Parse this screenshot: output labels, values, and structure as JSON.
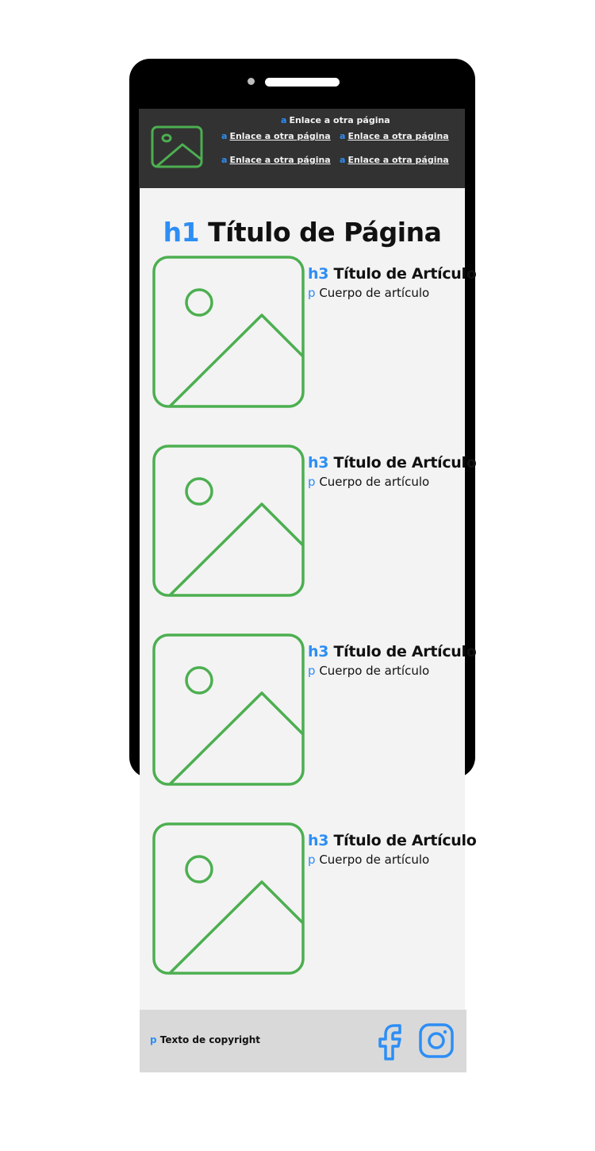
{
  "header": {
    "logo_icon": "image-placeholder-icon",
    "link_tag": "a",
    "links": [
      "Enlace a otra página",
      "Enlace a otra página",
      "Enlace a otra página",
      "Enlace a otra página",
      "Enlace a otra página"
    ]
  },
  "page": {
    "title_tag": "h1",
    "title": "Título de Página"
  },
  "articles": [
    {
      "title_tag": "h3",
      "title": "Título de Artículo",
      "body_tag": "p",
      "body": "Cuerpo de artículo",
      "image_icon": "image-placeholder-icon"
    },
    {
      "title_tag": "h3",
      "title": "Título de Artículo",
      "body_tag": "p",
      "body": "Cuerpo de artículo",
      "image_icon": "image-placeholder-icon"
    },
    {
      "title_tag": "h3",
      "title": "Título de Artículo",
      "body_tag": "p",
      "body": "Cuerpo de artículo",
      "image_icon": "image-placeholder-icon"
    },
    {
      "title_tag": "h3",
      "title": "Título de Artículo",
      "body_tag": "p",
      "body": "Cuerpo de artículo",
      "image_icon": "image-placeholder-icon"
    }
  ],
  "footer": {
    "copyright_tag": "p",
    "copyright": "Texto de copyright",
    "social_icons": [
      "facebook-icon",
      "instagram-icon"
    ]
  },
  "colors": {
    "tag_blue": "#2d8ef5",
    "placeholder_green": "#4caf50",
    "header_bg": "#323232",
    "content_bg": "#f3f3f3",
    "footer_bg": "#d9d9d9",
    "phone_frame": "#000000"
  }
}
